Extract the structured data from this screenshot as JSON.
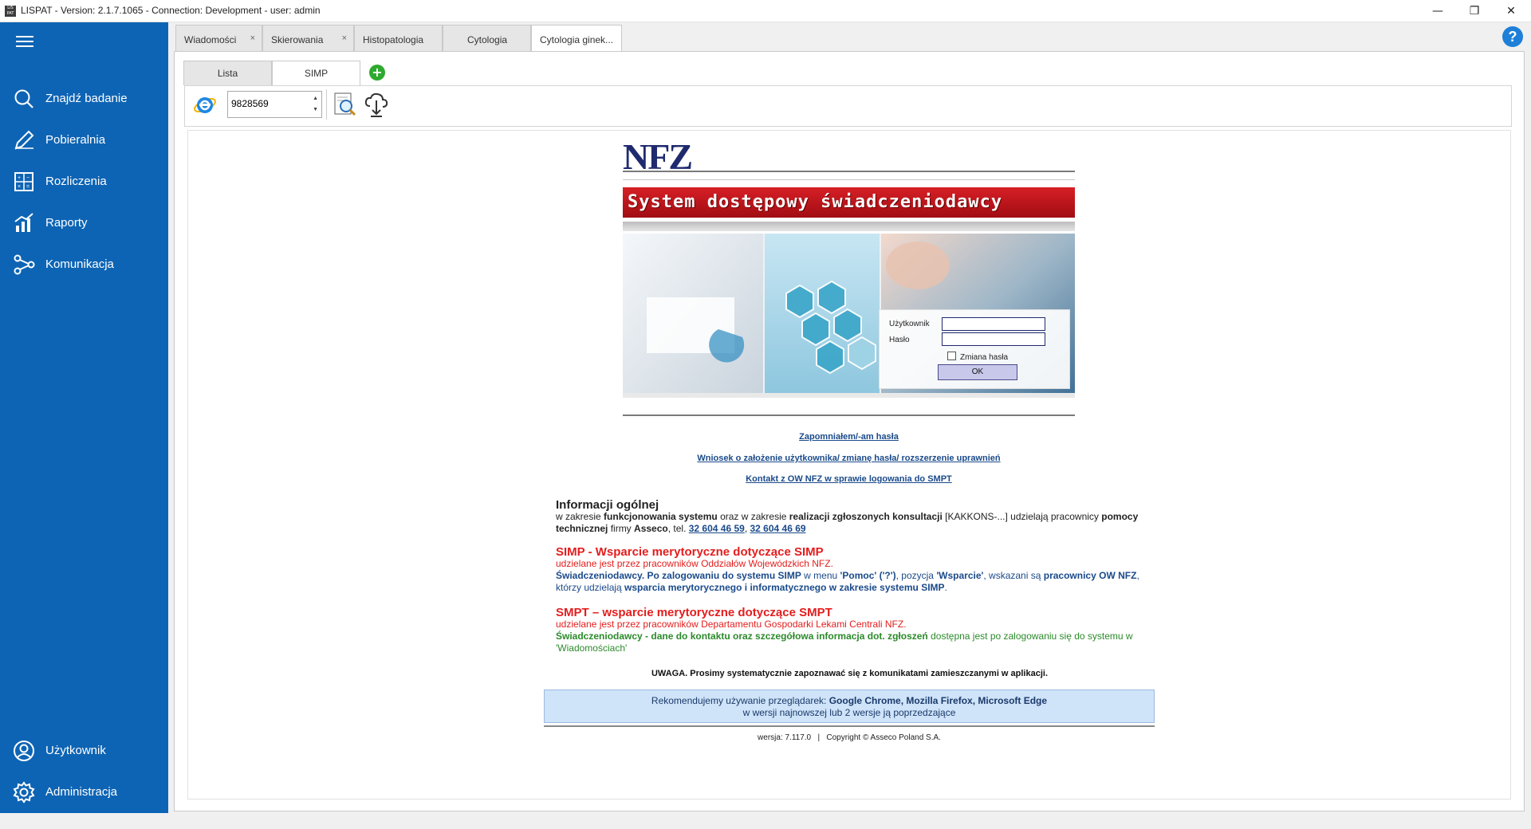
{
  "window": {
    "title": "LISPAT - Version: 2.1.7.1065 - Connection: Development - user: admin",
    "icon_text": "LIS PAT",
    "controls": [
      "minimize-icon",
      "restore-icon",
      "close-icon"
    ]
  },
  "sidebar": {
    "menu_icon": "hamburger-icon",
    "items": [
      {
        "label": "Znajdź badanie",
        "icon": "search-icon"
      },
      {
        "label": "Pobieralnia",
        "icon": "pen-icon"
      },
      {
        "label": "Rozliczenia",
        "icon": "calculator-icon"
      },
      {
        "label": "Raporty",
        "icon": "chart-icon"
      },
      {
        "label": "Komunikacja",
        "icon": "share-icon"
      }
    ],
    "bottom_items": [
      {
        "label": "Użytkownik",
        "icon": "user-icon"
      },
      {
        "label": "Administracja",
        "icon": "gear-icon"
      }
    ]
  },
  "tabs": [
    {
      "label": "Wiadomości",
      "closable": true
    },
    {
      "label": "Skierowania",
      "closable": true
    },
    {
      "label": "Histopatologia"
    },
    {
      "label": "Cytologia"
    },
    {
      "label": "Cytologia ginek...",
      "active": true
    }
  ],
  "close_glyph": "×",
  "help_glyph": "?",
  "subtabs": [
    {
      "label": "Lista"
    },
    {
      "label": "SIMP",
      "active": true
    }
  ],
  "add_glyph": "+",
  "toolbar": {
    "id_value": "9828569",
    "spin_up": "▲",
    "spin_down": "▼"
  },
  "nfz": {
    "logo": "NFZ",
    "banner": "System dostępowy świadczeniodawcy",
    "login": {
      "user_label": "Użytkownik",
      "password_label": "Hasło",
      "change_password_label": "Zmiana hasła",
      "ok_label": "OK"
    },
    "links": [
      "Zapomniałem/-am hasła",
      "Wniosek o założenie użytkownika/ zmianę hasła/ rozszerzenie uprawnień",
      "Kontakt z OW NFZ w sprawie logowania do SMPT"
    ],
    "info_general": {
      "heading": "Informacji ogólnej",
      "t1": "w zakresie ",
      "b1": "funkcjonowania systemu",
      "t2": " oraz w zakresie ",
      "b2": "realizacji zgłoszonych konsultacji",
      "t3": " [KAKKONS-...] udzielają pracownicy ",
      "b3": "pomocy technicznej",
      "t4": " firmy ",
      "b4": "Asseco",
      "t5": ", tel. ",
      "phone1": "32 604 46 59",
      "sep": ", ",
      "phone2": "32 604 46 69"
    },
    "info_simp": {
      "heading": "SIMP - Wsparcie merytoryczne dotyczące SIMP",
      "line1": "udzielane jest przez pracowników Oddziałów Wojewódzkich NFZ.",
      "b1": "Świadczeniodawcy. Po zalogowaniu do systemu SIMP",
      "t1": " w menu ",
      "b2": "'Pomoc' ('?')",
      "t2": ", pozycja ",
      "b3": "'Wsparcie'",
      "t3": ", wskazani są ",
      "b4": "pracownicy OW NFZ",
      "t4": ", którzy udzielają ",
      "b5": "wsparcia merytorycznego i informatycznego w zakresie systemu SIMP",
      "t5": "."
    },
    "info_smpt": {
      "heading": "SMPT – wsparcie merytoryczne dotyczące SMPT",
      "line1": "udzielane jest przez pracowników Departamentu Gospodarki Lekami Centrali NFZ.",
      "b1": "Świadczeniodawcy - dane do kontaktu oraz szczegółowa informacja dot. zgłoszeń",
      "t1": " dostępna jest po zalogowaniu się do systemu w 'Wiadomościach'"
    },
    "uwaga": "UWAGA. Prosimy systematycznie zapoznawać się z komunikatami zamieszczanymi w aplikacji.",
    "browsers": {
      "prefix": "Rekomendujemy używanie przeglądarek: ",
      "names": "Google Chrome, Mozilla Firefox, Microsoft Edge",
      "line2": "w wersji najnowszej lub 2 wersje ją poprzedzające"
    },
    "footer": "wersja: 7.117.0   |   Copyright © Asseco Poland S.A."
  },
  "colors": {
    "sidebar": "#0e64b4",
    "banner_red": "#d71f26",
    "nfz_navy": "#1f2a6e",
    "link_blue": "#1a4a8a",
    "simp_red": "#e31d1d",
    "smpt_green": "#2b8a2b"
  }
}
